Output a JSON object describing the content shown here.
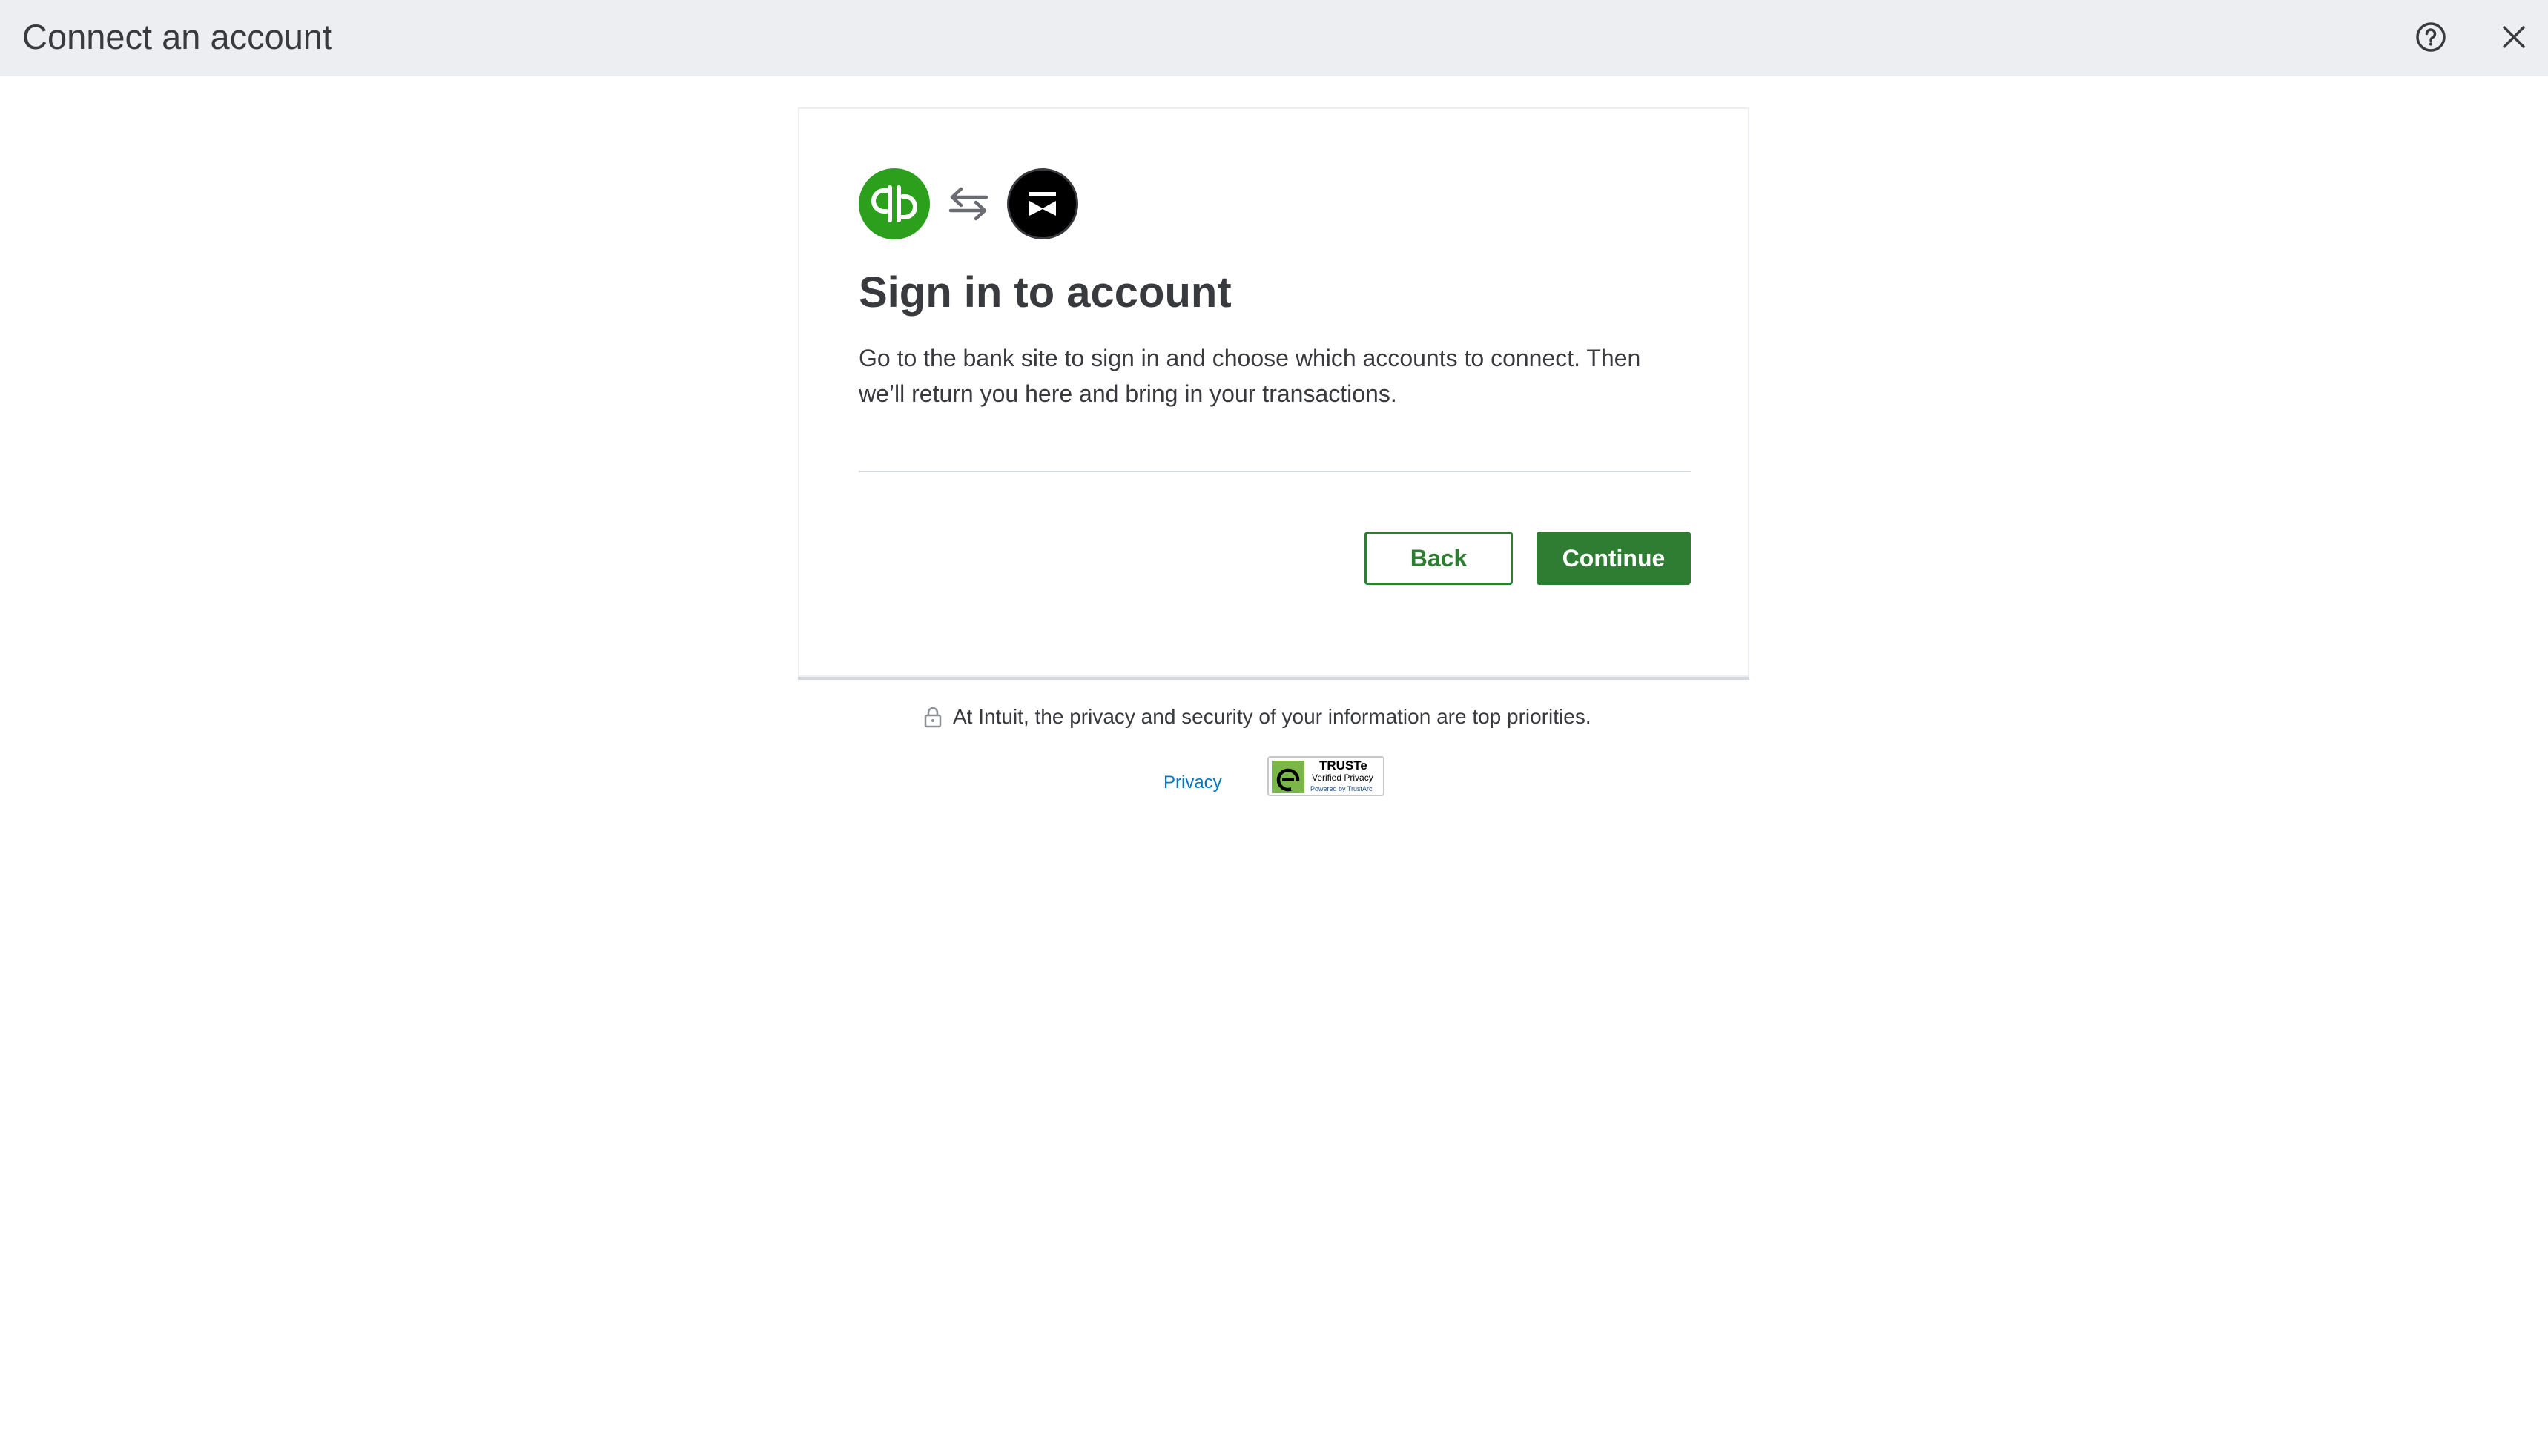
{
  "header": {
    "title": "Connect an account",
    "icons": [
      "help-icon",
      "close-icon"
    ]
  },
  "card": {
    "logos": {
      "left": "quickbooks-logo",
      "middle": "swap-arrows-icon",
      "right": "bank-logo"
    },
    "title": "Sign in to account",
    "description": "Go to the bank site to sign in and choose which accounts to connect. Then we’ll return you here and bring in your transactions.",
    "buttons": {
      "back_label": "Back",
      "continue_label": "Continue"
    }
  },
  "footer": {
    "security_text": "At Intuit, the privacy and security of your information are top priorities.",
    "privacy_link": "Privacy",
    "truste_badge": {
      "name": "TRUSTe",
      "subtitle": "Verified Privacy",
      "powered_by": "Powered by TrustArc"
    }
  },
  "colors": {
    "header_bg": "#eceef1",
    "brand_green": "#2ca01c",
    "button_green": "#2e7d32",
    "link_blue": "#0077c5",
    "text": "#393a3d"
  }
}
